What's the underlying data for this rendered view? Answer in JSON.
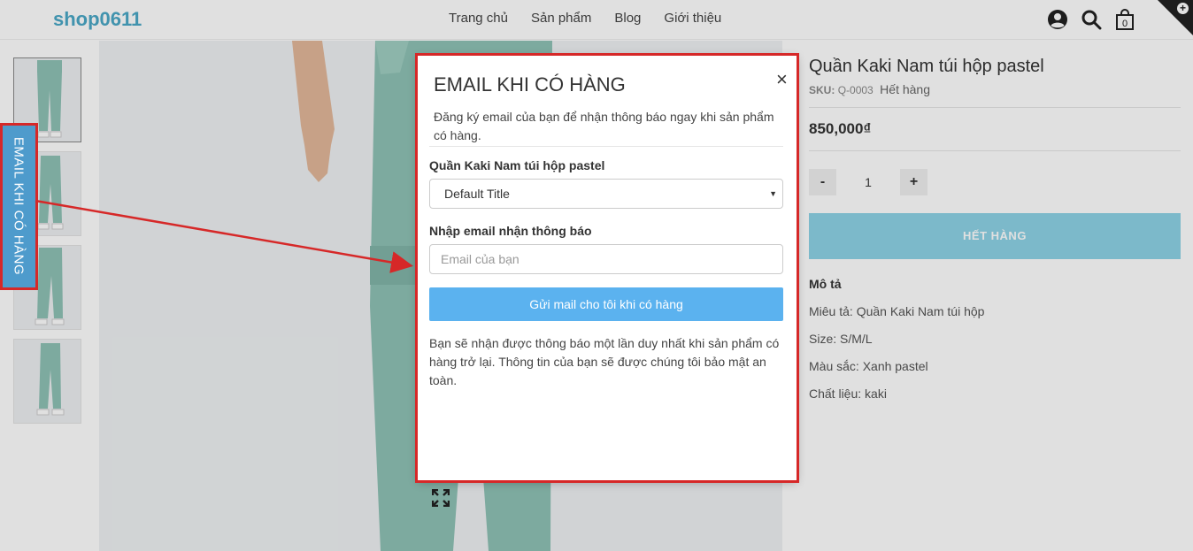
{
  "header": {
    "logo": "shop0611",
    "nav": [
      "Trang chủ",
      "Sản phẩm",
      "Blog",
      "Giới thiệu"
    ],
    "cart_count": "0",
    "icons": [
      "user-icon",
      "search-icon",
      "cart-icon"
    ]
  },
  "side_tab": {
    "label": "EMAIL KHI CÓ HÀNG"
  },
  "product": {
    "title": "Quần Kaki Nam túi hộp pastel",
    "sku_label": "SKU:",
    "sku": "Q-0003",
    "stock": "Hết hàng",
    "price": "850,000₫",
    "qty_minus": "-",
    "qty_value": "1",
    "qty_plus": "+",
    "soldout_button": "HẾT HÀNG",
    "description_heading": "Mô tả",
    "description": [
      "Miêu tả: Quần Kaki Nam túi hộp",
      "Size: S/M/L",
      "Màu sắc: Xanh pastel",
      "Chất liệu: kaki"
    ]
  },
  "modal": {
    "title": "EMAIL KHI CÓ HÀNG",
    "close": "×",
    "subtitle": "Đăng ký email của bạn để nhận thông báo ngay khi sản phẩm có hàng.",
    "product_label": "Quần Kaki Nam túi hộp pastel",
    "variant_selected": "Default Title",
    "email_label": "Nhập email nhận thông báo",
    "email_placeholder": "Email của bạn",
    "submit_button": "Gửi mail cho tôi khi có hàng",
    "note": "Bạn sẽ nhận được thông báo một lần duy nhất khi sản phẩm có hàng trở lại. Thông tin của bạn sẽ được chúng tôi bảo mật an toàn."
  },
  "colors": {
    "brand": "#4aa8c6",
    "side_tab": "#4e9bcc",
    "highlight": "#d62828",
    "submit": "#5bb2ef",
    "soldout": "#8ed3e6",
    "pants": "#8fc2b6"
  }
}
